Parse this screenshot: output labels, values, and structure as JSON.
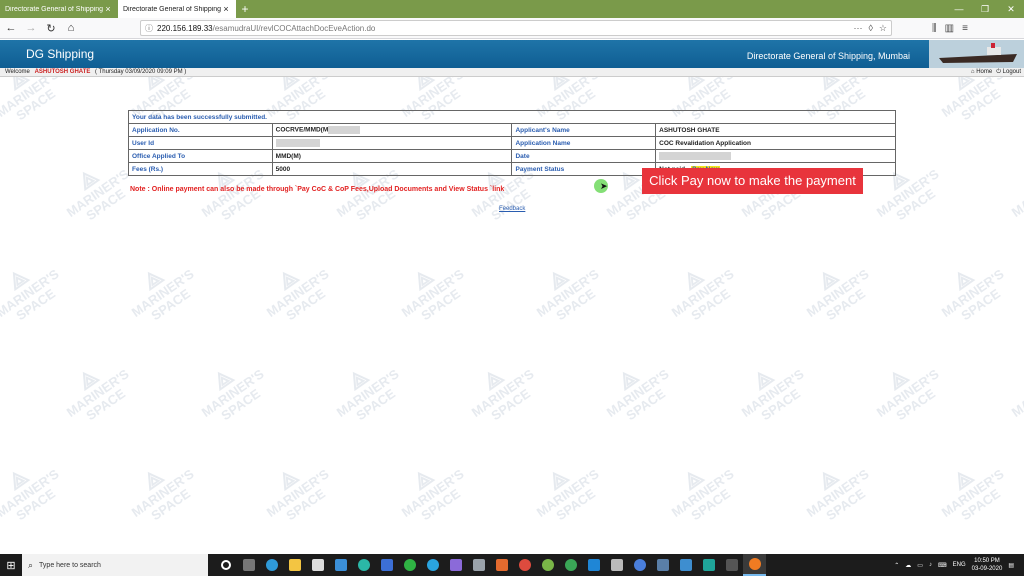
{
  "browser": {
    "tabs": [
      {
        "label": "Directorate General of Shipping - Go",
        "active": false
      },
      {
        "label": "Directorate General of Shipping",
        "active": true
      }
    ],
    "new_tab": "+",
    "url_host": "220.156.189.33",
    "url_path": "/esamudraUI/revlCOCAttachDocEveAction.do",
    "url_right_icons": [
      "more-icon",
      "pocket-icon",
      "bookmark-star-icon"
    ]
  },
  "site": {
    "logo_text": "DG Shipping",
    "org_name": "Directorate General of Shipping, Mumbai",
    "welcome_label": "Welcome",
    "user_name": "ASHUTOSH GHATE",
    "login_time": "( Thursday 03/09/2020 09:09 PM )",
    "home_link": "Home",
    "logout_link": "Logout"
  },
  "submission": {
    "message": "Your data has been successfully submitted.",
    "rows": [
      {
        "label1": "Application No.",
        "value1": "COCRVE/MMD(M",
        "label2": "Applicant's Name",
        "value2": "ASHUTOSH GHATE"
      },
      {
        "label1": "User Id",
        "value1": "",
        "label2": "Application Name",
        "value2": "COC Revalidation Application"
      },
      {
        "label1": "Office Applied To",
        "value1": "MMD(M)",
        "label2": "Date",
        "value2": ""
      },
      {
        "label1": "Fees (Rs.)",
        "value1": "5000",
        "label2": "Payment Status",
        "value2": "Not paid"
      }
    ],
    "pay_now": "Pay Now",
    "note": "Note : Online payment can also be made through `Pay CoC & CoP Fees,Upload Documents and View Status `link",
    "feedback": "Feedback"
  },
  "callout": "Click Pay now to make the payment",
  "watermark": {
    "line1": "MARINER'S",
    "line2": "SPACE"
  },
  "taskbar": {
    "search_placeholder": "Type here to search",
    "language": "ENG",
    "time": "10:50 PM",
    "date": "03-09-2020"
  },
  "colors": {
    "header_blue": "#1468a0",
    "label_blue": "#2a5db0",
    "note_red": "#e22222",
    "callout_red": "#e8343c",
    "pay_now_highlight": "#f5e51a",
    "tab_bar_green": "#7a9a4a"
  }
}
